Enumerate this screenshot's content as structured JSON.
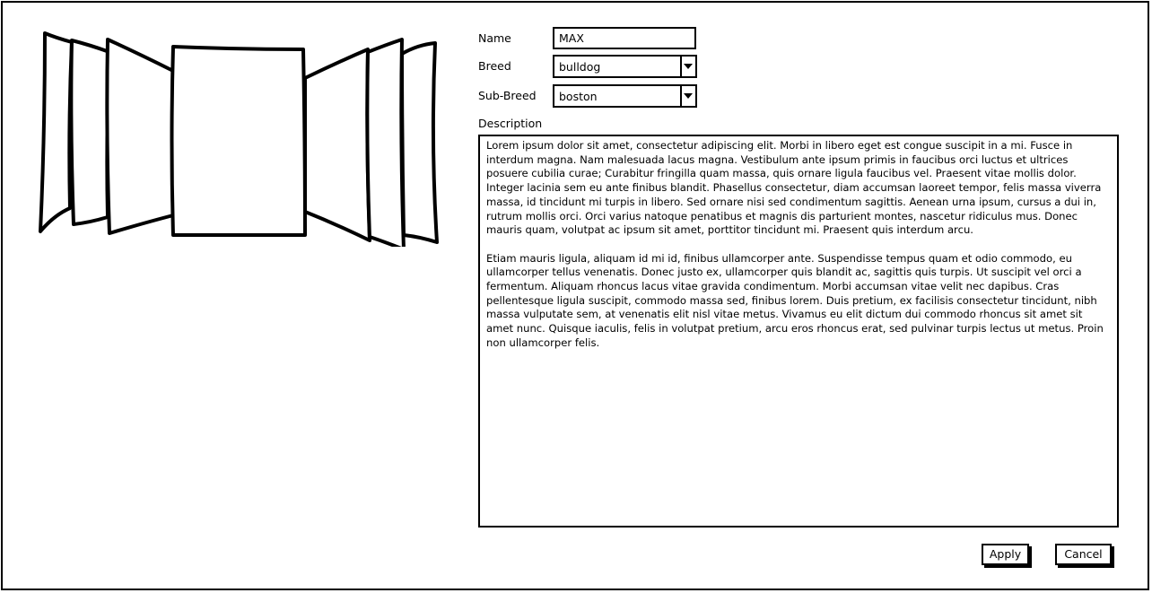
{
  "form": {
    "name_label": "Name",
    "name_value": "MAX",
    "breed_label": "Breed",
    "breed_value": "bulldog",
    "sub_breed_label": "Sub-Breed",
    "sub_breed_value": "boston",
    "description_label": "Description",
    "description_paragraphs": [
      "Lorem ipsum dolor sit amet, consectetur adipiscing elit. Morbi in libero eget est congue suscipit in a mi. Fusce in interdum magna. Nam malesuada lacus magna. Vestibulum ante ipsum primis in faucibus orci luctus et ultrices posuere cubilia curae; Curabitur fringilla quam massa, quis ornare ligula faucibus vel. Praesent vitae mollis dolor. Integer lacinia sem eu ante finibus blandit. Phasellus consectetur, diam accumsan laoreet tempor, felis massa viverra massa, id tincidunt mi turpis in libero. Sed ornare nisi sed condimentum sagittis. Aenean urna ipsum, cursus a dui in, rutrum mollis orci. Orci varius natoque penatibus et magnis dis parturient montes, nascetur ridiculus mus. Donec mauris quam, volutpat ac ipsum sit amet, porttitor tincidunt mi. Praesent quis interdum arcu.",
      "Etiam mauris ligula, aliquam id mi id, finibus ullamcorper ante. Suspendisse tempus quam et odio commodo, eu ullamcorper tellus venenatis. Donec justo ex, ullamcorper quis blandit ac, sagittis quis turpis. Ut suscipit vel orci a fermentum. Aliquam rhoncus lacus vitae gravida condimentum. Morbi accumsan vitae velit nec dapibus. Cras pellentesque ligula suscipit, commodo massa sed, finibus lorem. Duis pretium, ex facilisis consectetur tincidunt, nibh massa vulputate sem, at venenatis elit nisl vitae metus. Vivamus eu elit dictum dui commodo rhoncus sit amet sit amet nunc. Quisque iaculis, felis in volutpat pretium, arcu eros rhoncus erat, sed pulvinar turpis lectus ut metus. Proin non ullamcorper felis."
    ]
  },
  "actions": {
    "apply_label": "Apply",
    "cancel_label": "Cancel"
  },
  "gallery": {
    "type": "cover-flow"
  }
}
